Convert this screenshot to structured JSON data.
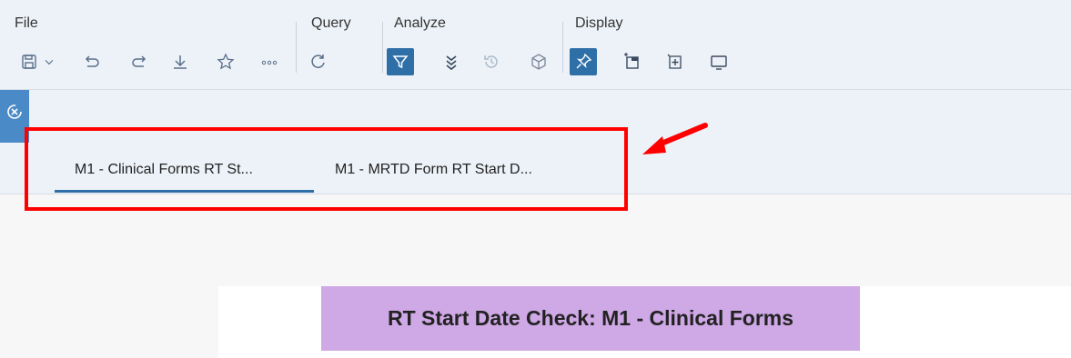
{
  "toolbar": {
    "groups": {
      "file": "File",
      "query": "Query",
      "analyze": "Analyze",
      "display": "Display"
    }
  },
  "tabs": [
    {
      "label": "M1 - Clinical Forms RT St...",
      "selected": true
    },
    {
      "label": "M1 - MRTD Form RT Start D...",
      "selected": false
    }
  ],
  "content": {
    "title": "RT Start Date Check: M1 - Clinical Forms"
  },
  "colors": {
    "accent": "#2e6fa8",
    "highlight": "#ff0000",
    "title_bg": "#cfa8e6"
  },
  "icons": [
    "save-icon",
    "dropdown-chevron-icon",
    "undo-icon",
    "redo-icon",
    "download-icon",
    "star-icon",
    "more-icon",
    "refresh-icon",
    "filter-icon",
    "expand-all-icon",
    "history-icon",
    "cube-icon",
    "pin-icon",
    "sticky-note-icon",
    "add-table-icon",
    "monitor-icon",
    "close-navigation-icon"
  ]
}
